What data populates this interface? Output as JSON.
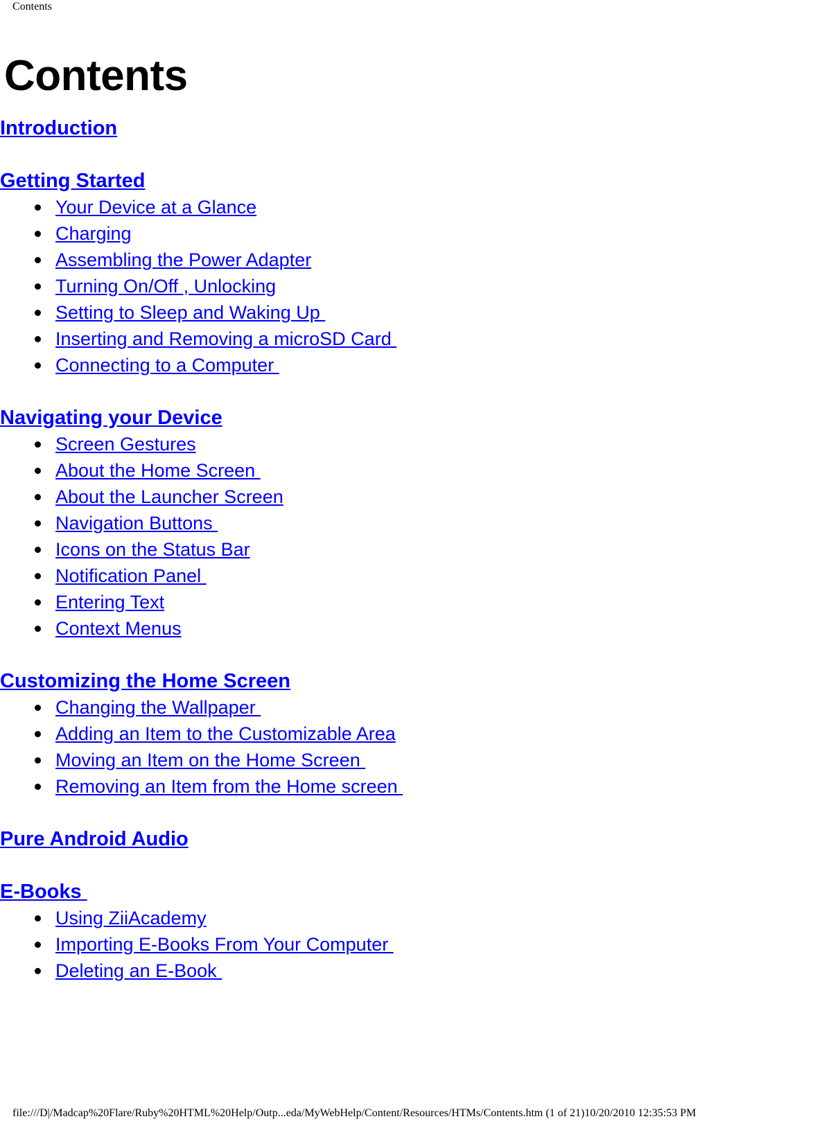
{
  "page": {
    "running_header": "Contents",
    "title": "Contents",
    "footer": "file:///D|/Madcap%20Flare/Ruby%20HTML%20Help/Outp...eda/MyWebHelp/Content/Resources/HTMs/Contents.htm (1 of 21)10/20/2010 12:35:53 PM",
    "link_color": "#0000ff",
    "text_color": "#000000",
    "background_color": "#ffffff"
  },
  "toc": {
    "sections": [
      {
        "heading": "Introduction",
        "items": []
      },
      {
        "heading": "Getting Started",
        "items": [
          "Your Device at a Glance",
          "Charging",
          "Assembling the Power Adapter",
          "Turning On/Off , Unlocking",
          "Setting to Sleep and Waking Up ",
          "Inserting and Removing a microSD Card ",
          "Connecting to a Computer "
        ]
      },
      {
        "heading": "Navigating your Device",
        "items": [
          "Screen Gestures",
          "About the Home Screen ",
          "About the Launcher Screen",
          "Navigation Buttons ",
          "Icons on the Status Bar",
          "Notification Panel ",
          "Entering Text",
          "Context Menus"
        ]
      },
      {
        "heading": "Customizing the Home Screen",
        "items": [
          "Changing the Wallpaper ",
          "Adding an Item to the Customizable Area",
          "Moving an Item on the Home Screen ",
          "Removing an Item from the Home screen "
        ]
      },
      {
        "heading": "Pure Android Audio",
        "items": []
      },
      {
        "heading": "E-Books ",
        "items": [
          "Using ZiiAcademy",
          "Importing E-Books From Your Computer ",
          "Deleting an E-Book "
        ]
      }
    ]
  }
}
